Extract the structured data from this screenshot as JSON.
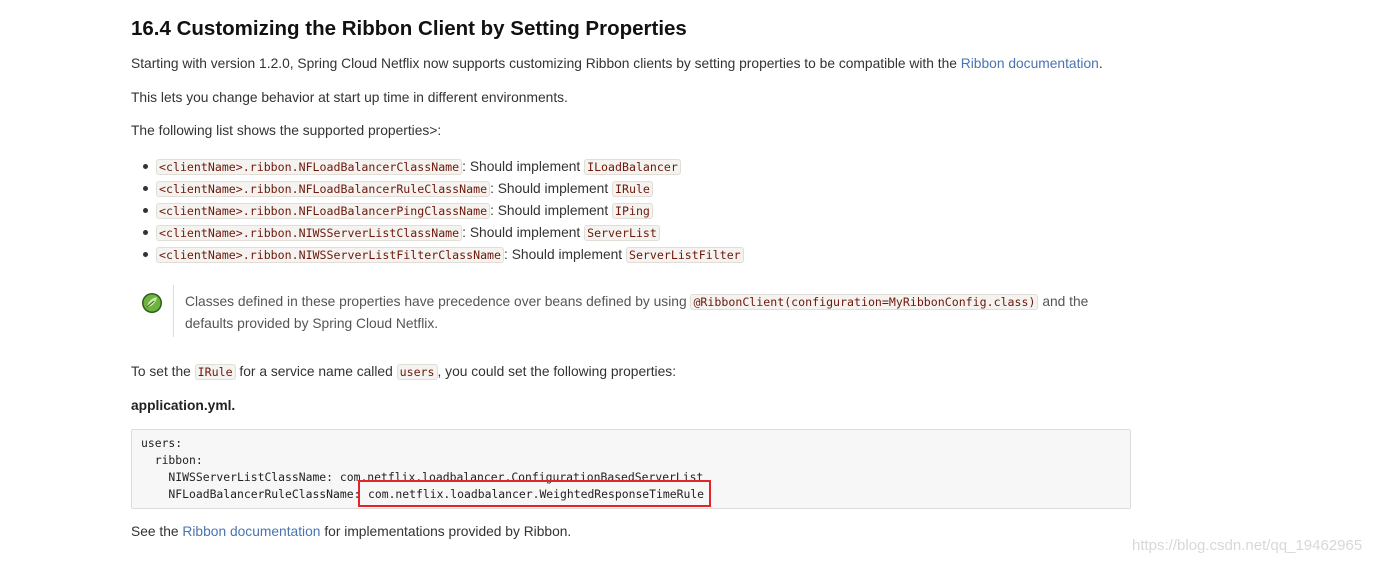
{
  "heading": "16.4 Customizing the Ribbon Client by Setting Properties",
  "intro": {
    "text": "Starting with version 1.2.0, Spring Cloud Netflix now supports customizing Ribbon clients by setting properties to be compatible with the ",
    "link": "Ribbon documentation",
    "end": "."
  },
  "para2": "This lets you change behavior at start up time in different environments.",
  "para3": "The following list shows the supported properties>:",
  "properties": [
    {
      "code": "<clientName>.ribbon.NFLoadBalancerClassName",
      "text": ": Should implement ",
      "iface": "ILoadBalancer"
    },
    {
      "code": "<clientName>.ribbon.NFLoadBalancerRuleClassName",
      "text": ": Should implement ",
      "iface": "IRule"
    },
    {
      "code": "<clientName>.ribbon.NFLoadBalancerPingClassName",
      "text": ": Should implement ",
      "iface": "IPing"
    },
    {
      "code": "<clientName>.ribbon.NIWSServerListClassName",
      "text": ": Should implement ",
      "iface": "ServerList"
    },
    {
      "code": "<clientName>.ribbon.NIWSServerListFilterClassName",
      "text": ": Should implement ",
      "iface": "ServerListFilter"
    }
  ],
  "note": {
    "text1": "Classes defined in these properties have precedence over beans defined by using ",
    "code": "@RibbonClient(configuration=MyRibbonConfig.class)",
    "text2": " and the defaults provided by Spring Cloud Netflix."
  },
  "rule_para": {
    "t1": "To set the ",
    "c1": "IRule",
    "t2": " for a service name called ",
    "c2": "users",
    "t3": ", you could set the following properties:"
  },
  "file_title": "application.yml.",
  "code_lines": [
    "users:",
    "  ribbon:",
    "    NIWSServerListClassName: com.netflix.loadbalancer.ConfigurationBasedServerList",
    "    NFLoadBalancerRuleClassName: ",
    "com.netflix.loadbalancer.WeightedResponseTimeRule"
  ],
  "footer": {
    "t1": "See the ",
    "link": "Ribbon documentation",
    "t2": " for implementations provided by Ribbon."
  },
  "watermark": "https://blog.csdn.net/qq_19462965",
  "colors": {
    "link": "#4a74b0",
    "code_text": "#6d180b",
    "highlight_border": "#e0262a",
    "spring_green": "#6db33f"
  }
}
